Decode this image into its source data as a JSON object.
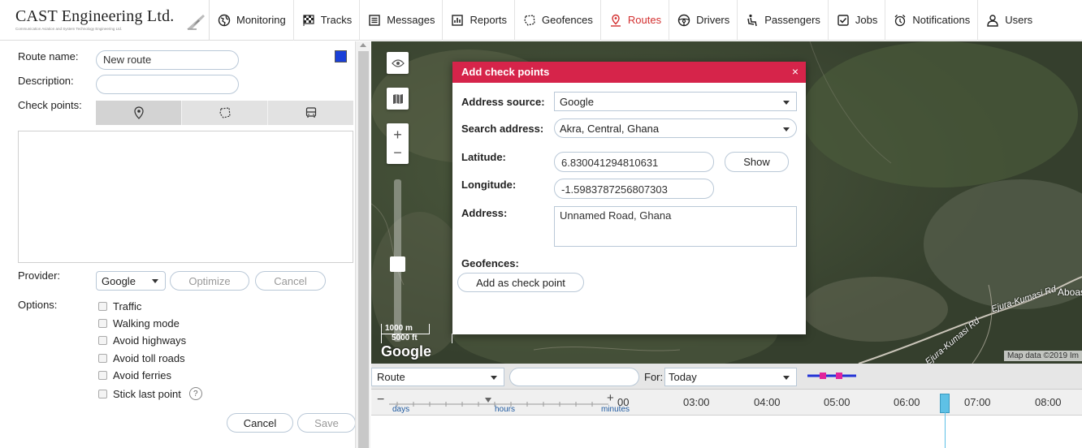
{
  "header": {
    "logo_name": "CAST Engineering Ltd.",
    "logo_tagline": "Communication Aviation and System Technology Engineering Ltd.",
    "nav": [
      {
        "label": "Monitoring",
        "icon": "globe-icon"
      },
      {
        "label": "Tracks",
        "icon": "flag-icon"
      },
      {
        "label": "Messages",
        "icon": "message-icon"
      },
      {
        "label": "Reports",
        "icon": "report-icon"
      },
      {
        "label": "Geofences",
        "icon": "geofence-icon"
      },
      {
        "label": "Routes",
        "icon": "route-icon",
        "active": true
      },
      {
        "label": "Drivers",
        "icon": "steering-wheel-icon"
      },
      {
        "label": "Passengers",
        "icon": "passenger-icon"
      },
      {
        "label": "Jobs",
        "icon": "checkbox-icon"
      },
      {
        "label": "Notifications",
        "icon": "alarm-icon"
      },
      {
        "label": "Users",
        "icon": "user-icon"
      }
    ],
    "accent_color": "#d32f2f"
  },
  "route_form": {
    "route_name_label": "Route name:",
    "route_name_value": "New route",
    "route_color": "#1a40d8",
    "description_label": "Description:",
    "description_value": "",
    "checkpoints_label": "Check points:",
    "checkpoint_tabs": [
      "location-pin-icon",
      "polygon-icon",
      "bus-icon"
    ],
    "provider_label": "Provider:",
    "provider_value": "Google",
    "optimize_label": "Optimize",
    "cancel_top_label": "Cancel",
    "options_label": "Options:",
    "options": [
      "Traffic",
      "Walking mode",
      "Avoid highways",
      "Avoid toll roads",
      "Avoid ferries",
      "Stick last point"
    ],
    "cancel_label": "Cancel",
    "save_label": "Save"
  },
  "map": {
    "scale_metric": "1000 m",
    "scale_imperial": "5000 ft",
    "google_logo": "Google",
    "map_data": "Map data ©2019 Im",
    "roads": [
      "Ejura-Kumasi Rd",
      "Aboas",
      "Ejura-Kumasi Rd"
    ]
  },
  "dialog": {
    "title": "Add check points",
    "close": "×",
    "address_source_label": "Address source:",
    "address_source_value": "Google",
    "search_address_label": "Search address:",
    "search_address_value": "Akra, Central, Ghana",
    "latitude_label": "Latitude:",
    "latitude_value": "6.830041294810631",
    "show_label": "Show",
    "longitude_label": "Longitude:",
    "longitude_value": "-1.5983787256807303",
    "address_label": "Address:",
    "address_value": "Unnamed Road, Ghana",
    "geofences_label": "Geofences:",
    "add_button": "Add as check point",
    "header_color": "#d6244a"
  },
  "timeline": {
    "route_select": "Route",
    "for_label": "For:",
    "period_value": "Today",
    "scale_days": "days",
    "scale_hours": "hours",
    "scale_minutes": "minutes",
    "hours": [
      "00",
      "03:00",
      "04:00",
      "05:00",
      "06:00",
      "07:00",
      "08:00"
    ]
  }
}
